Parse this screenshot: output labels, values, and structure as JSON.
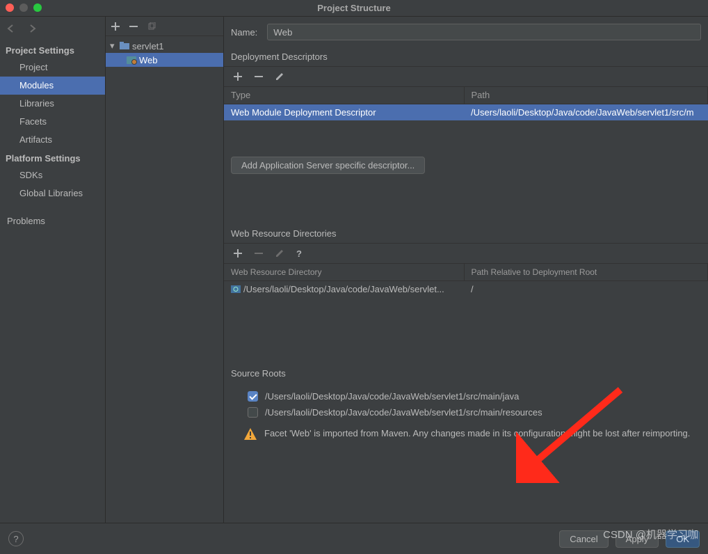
{
  "title": "Project Structure",
  "leftNav": {
    "projectSettingsHeading": "Project Settings",
    "items": [
      "Project",
      "Modules",
      "Libraries",
      "Facets",
      "Artifacts"
    ],
    "platformSettingsHeading": "Platform Settings",
    "platformItems": [
      "SDKs",
      "Global Libraries"
    ],
    "problems": "Problems",
    "selectedIndex": 1
  },
  "tree": {
    "root": "servlet1",
    "child": "Web"
  },
  "content": {
    "nameLabel": "Name:",
    "nameValue": "Web",
    "deployment": {
      "heading": "Deployment Descriptors",
      "cols": [
        "Type",
        "Path"
      ],
      "row": {
        "type": "Web Module Deployment Descriptor",
        "path": "/Users/laoli/Desktop/Java/code/JavaWeb/servlet1/src/m"
      },
      "addBtn": "Add Application Server specific descriptor..."
    },
    "webResources": {
      "heading": "Web Resource Directories",
      "cols": [
        "Web Resource Directory",
        "Path Relative to Deployment Root"
      ],
      "row": {
        "dir": "/Users/laoli/Desktop/Java/code/JavaWeb/servlet...",
        "rel": "/"
      }
    },
    "sourceRoots": {
      "heading": "Source Roots",
      "items": [
        {
          "checked": true,
          "path": "/Users/laoli/Desktop/Java/code/JavaWeb/servlet1/src/main/java"
        },
        {
          "checked": false,
          "path": "/Users/laoli/Desktop/Java/code/JavaWeb/servlet1/src/main/resources"
        }
      ]
    },
    "warning": "Facet 'Web' is imported from Maven. Any changes made in its configuration might be lost after reimporting."
  },
  "footer": {
    "cancel": "Cancel",
    "apply": "Apply",
    "ok": "OK"
  },
  "watermark": "CSDN @机器学习咖"
}
